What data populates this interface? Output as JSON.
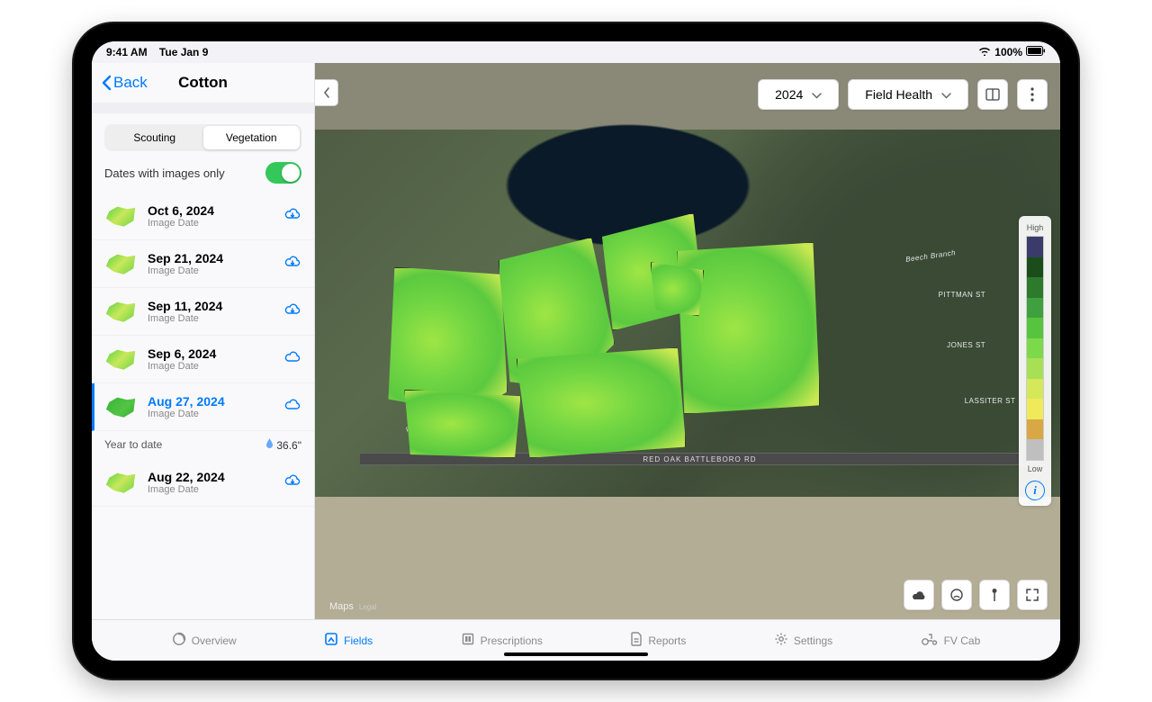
{
  "status": {
    "time": "9:41 AM",
    "date": "Tue Jan 9",
    "battery": "100%"
  },
  "sidebar": {
    "back": "Back",
    "title": "Cotton",
    "tabs": {
      "scouting": "Scouting",
      "vegetation": "Vegetation"
    },
    "toggle_label": "Dates with images only",
    "sub": "Image Date",
    "ytd_label": "Year to date",
    "ytd_value": "36.6\"",
    "dates": [
      {
        "label": "Oct 6, 2024"
      },
      {
        "label": "Sep 21, 2024"
      },
      {
        "label": "Sep 11, 2024"
      },
      {
        "label": "Sep 6, 2024"
      },
      {
        "label": "Aug 27, 2024"
      },
      {
        "label": "Aug 22, 2024"
      }
    ]
  },
  "map": {
    "year": "2024",
    "layer": "Field Health",
    "attribution": "Maps",
    "legal": "Legal",
    "legend_high": "High",
    "legend_low": "Low",
    "roads": {
      "main": "RED OAK BATTLEBORO RD",
      "side": "RED OAK-BATTLEBORO RD"
    },
    "streets": {
      "pittman": "PITTMAN ST",
      "jones": "JONES ST",
      "lassiter": "LASSITER ST",
      "beech": "Beech Branch"
    }
  },
  "tabs": {
    "overview": "Overview",
    "fields": "Fields",
    "prescriptions": "Prescriptions",
    "reports": "Reports",
    "settings": "Settings",
    "fvcab": "FV Cab"
  }
}
